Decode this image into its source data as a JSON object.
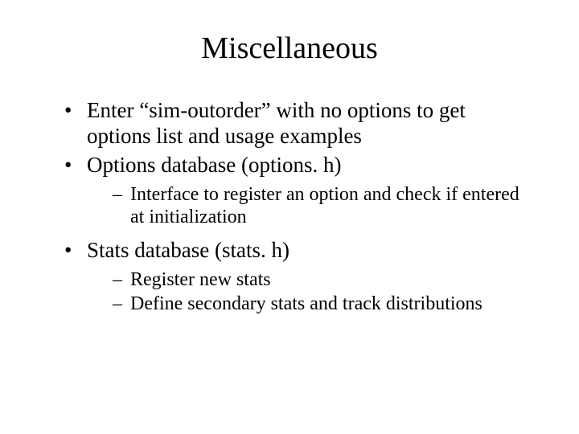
{
  "title": "Miscellaneous",
  "bullets": [
    {
      "text": "Enter “sim-outorder” with no options to get options list and usage examples"
    },
    {
      "text": "Options database (options. h)",
      "sub": [
        "Interface to register an option and check if entered at initialization"
      ]
    },
    {
      "text": "Stats database (stats. h)",
      "sub": [
        "Register new stats",
        "Define secondary stats and track distributions"
      ]
    }
  ]
}
